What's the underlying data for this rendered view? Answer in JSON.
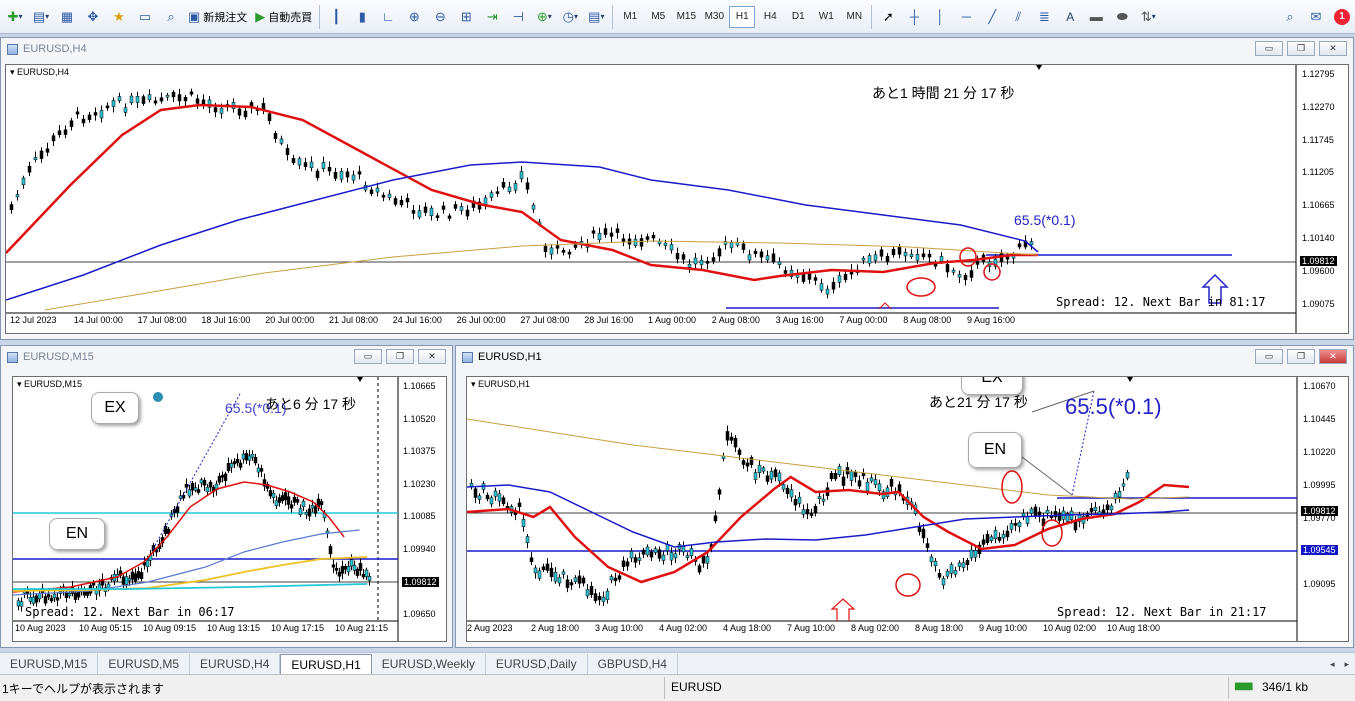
{
  "toolbar": {
    "new_order_label": "新規注文",
    "auto_trade_label": "自動売買",
    "timeframes": [
      "M1",
      "M5",
      "M15",
      "M30",
      "H1",
      "H4",
      "D1",
      "W1",
      "MN"
    ],
    "active_timeframe": "H1",
    "text_tool_label": "A",
    "notification_count": "1"
  },
  "windows": {
    "h4": {
      "title": "EURUSD,H4",
      "symbol": "EURUSD,H4",
      "countdown": "あと1 時間 21 分 17 秒",
      "annotation": "65.5(*0.1)",
      "spread": "Spread: 12. Next Bar in 81:17",
      "prices": [
        "1.12795",
        "1.12270",
        "1.11745",
        "1.11205",
        "1.10665",
        "1.10140",
        "1.09600",
        "1.09075"
      ],
      "current_price": "1.09812",
      "times": [
        "12 Jul 2023",
        "14 Jul 00:00",
        "17 Jul 08:00",
        "18 Jul 16:00",
        "20 Jul 00:00",
        "21 Jul 08:00",
        "24 Jul 16:00",
        "26 Jul 00:00",
        "27 Jul 08:00",
        "28 Jul 16:00",
        "1 Aug 00:00",
        "2 Aug 08:00",
        "3 Aug 16:00",
        "7 Aug 00:00",
        "8 Aug 08:00",
        "9 Aug 16:00"
      ]
    },
    "m15": {
      "title": "EURUSD,M15",
      "symbol": "EURUSD,M15",
      "countdown": "あと6 分 17 秒",
      "annotation": "65.5(*0.1)",
      "spread": "Spread: 12. Next Bar in 06:17",
      "callout_ex": "EX",
      "callout_en": "EN",
      "prices": [
        "1.10665",
        "1.10520",
        "1.10375",
        "1.10230",
        "1.10085",
        "1.09940",
        "1.09795",
        "1.09650"
      ],
      "current_price": "1.09812",
      "times": [
        "10 Aug 2023",
        "10 Aug 05:15",
        "10 Aug 09:15",
        "10 Aug 13:15",
        "10 Aug 17:15",
        "10 Aug 21:15"
      ]
    },
    "h1": {
      "title": "EURUSD,H1",
      "symbol": "EURUSD,H1",
      "countdown": "あと21 分 17 秒",
      "annotation": "65.5(*0.1)",
      "spread": "Spread: 12. Next Bar in 21:17",
      "callout_ex": "EX",
      "callout_en": "EN",
      "prices": [
        "1.10670",
        "1.10445",
        "1.10220",
        "1.09995",
        "1.09770",
        "1.09320",
        "1.09095"
      ],
      "current_price": "1.09812",
      "blue_price": "1.09545",
      "times": [
        "2 Aug 2023",
        "2 Aug 18:00",
        "3 Aug 10:00",
        "4 Aug 02:00",
        "4 Aug 18:00",
        "7 Aug 10:00",
        "8 Aug 02:00",
        "8 Aug 18:00",
        "9 Aug 10:00",
        "10 Aug 02:00",
        "10 Aug 18:00"
      ]
    }
  },
  "tabs": [
    "EURUSD,M15",
    "EURUSD,M5",
    "EURUSD,H4",
    "EURUSD,H1",
    "EURUSD,Weekly",
    "EURUSD,Daily",
    "GBPUSD,H4"
  ],
  "active_tab": "EURUSD,H1",
  "status": {
    "help": "1キーでヘルプが表示されます",
    "symbol": "EURUSD",
    "traffic": "346/1 kb"
  },
  "colors": {
    "ma_fast": "#e01010",
    "ma_slow": "#1a1acc",
    "ma_long": "#c8a040",
    "ma_cyan": "#20c8d8",
    "ma_yellow": "#f0c020"
  }
}
